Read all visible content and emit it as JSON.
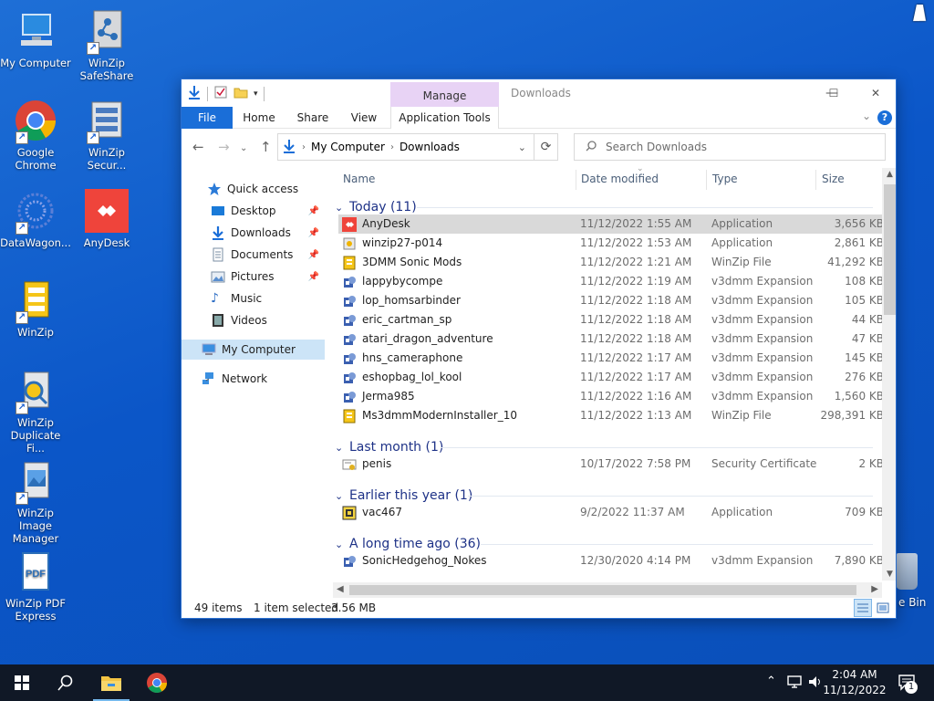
{
  "desktop": {
    "icons": [
      {
        "label": "My Computer"
      },
      {
        "label": "WinZip SafeShare"
      },
      {
        "label": "Google Chrome"
      },
      {
        "label": "WinZip Secur..."
      },
      {
        "label": "DataWagon..."
      },
      {
        "label": "AnyDesk"
      },
      {
        "label": "WinZip"
      },
      {
        "label": "WinZip Duplicate Fi..."
      },
      {
        "label": "WinZip Image Manager"
      },
      {
        "label": "WinZip PDF Express"
      }
    ],
    "recycle_bin_label": "e Bin"
  },
  "window": {
    "title": "Downloads",
    "manage_tab": "Manage",
    "ribbon_tabs": {
      "file": "File",
      "home": "Home",
      "share": "Share",
      "view": "View",
      "app_tools": "Application Tools"
    },
    "controls": {
      "minimize": "—",
      "maximize": "☐",
      "close": "✕"
    },
    "address": {
      "root": "My Computer",
      "current": "Downloads"
    },
    "search_placeholder": "Search Downloads"
  },
  "navpane": {
    "quick_access": "Quick access",
    "items": [
      {
        "label": "Desktop",
        "pinned": true
      },
      {
        "label": "Downloads",
        "pinned": true
      },
      {
        "label": "Documents",
        "pinned": true
      },
      {
        "label": "Pictures",
        "pinned": true
      },
      {
        "label": "Music",
        "pinned": false
      },
      {
        "label": "Videos",
        "pinned": false
      }
    ],
    "my_computer": "My Computer",
    "network": "Network"
  },
  "columns": {
    "name": "Name",
    "date": "Date modified",
    "type": "Type",
    "size": "Size"
  },
  "groups": {
    "today": "Today (11)",
    "last_month": "Last month (1)",
    "earlier_year": "Earlier this year (1)",
    "long_ago": "A long time ago (36)"
  },
  "files": {
    "today": [
      {
        "name": "AnyDesk",
        "date": "11/12/2022 1:55 AM",
        "type": "Application",
        "size": "3,656 KB",
        "icon": "anydesk-icon"
      },
      {
        "name": "winzip27-p014",
        "date": "11/12/2022 1:53 AM",
        "type": "Application",
        "size": "2,861 KB",
        "icon": "installer-icon"
      },
      {
        "name": "3DMM Sonic Mods",
        "date": "11/12/2022 1:21 AM",
        "type": "WinZip File",
        "size": "41,292 KB",
        "icon": "winzip-file-icon"
      },
      {
        "name": "lappybycompe",
        "date": "11/12/2022 1:19 AM",
        "type": "v3dmm Expansion",
        "size": "108 KB",
        "icon": "v3dmm-icon"
      },
      {
        "name": "lop_homsarbinder",
        "date": "11/12/2022 1:18 AM",
        "type": "v3dmm Expansion",
        "size": "105 KB",
        "icon": "v3dmm-icon"
      },
      {
        "name": "eric_cartman_sp",
        "date": "11/12/2022 1:18 AM",
        "type": "v3dmm Expansion",
        "size": "44 KB",
        "icon": "v3dmm-icon"
      },
      {
        "name": "atari_dragon_adventure",
        "date": "11/12/2022 1:18 AM",
        "type": "v3dmm Expansion",
        "size": "47 KB",
        "icon": "v3dmm-icon"
      },
      {
        "name": "hns_cameraphone",
        "date": "11/12/2022 1:17 AM",
        "type": "v3dmm Expansion",
        "size": "145 KB",
        "icon": "v3dmm-icon"
      },
      {
        "name": "eshopbag_lol_kool",
        "date": "11/12/2022 1:17 AM",
        "type": "v3dmm Expansion",
        "size": "276 KB",
        "icon": "v3dmm-icon"
      },
      {
        "name": "Jerma985",
        "date": "11/12/2022 1:16 AM",
        "type": "v3dmm Expansion",
        "size": "1,560 KB",
        "icon": "v3dmm-icon"
      },
      {
        "name": "Ms3dmmModernInstaller_10",
        "date": "11/12/2022 1:13 AM",
        "type": "WinZip File",
        "size": "298,391 KB",
        "icon": "winzip-file-icon"
      }
    ],
    "last_month": [
      {
        "name": "penis",
        "date": "10/17/2022 7:58 PM",
        "type": "Security Certificate",
        "size": "2 KB",
        "icon": "certificate-icon"
      }
    ],
    "earlier_year": [
      {
        "name": "vac467",
        "date": "9/2/2022 11:37 AM",
        "type": "Application",
        "size": "709 KB",
        "icon": "app-icon"
      }
    ],
    "long_ago": [
      {
        "name": "SonicHedgehog_Nokes",
        "date": "12/30/2020 4:14 PM",
        "type": "v3dmm Expansion",
        "size": "7,890 KB",
        "icon": "v3dmm-icon"
      }
    ]
  },
  "status": {
    "items": "49 items",
    "selected": "1 item selected",
    "size": "3.56 MB"
  },
  "taskbar": {
    "time": "2:04 AM",
    "date": "11/12/2022",
    "notification_count": "1"
  }
}
